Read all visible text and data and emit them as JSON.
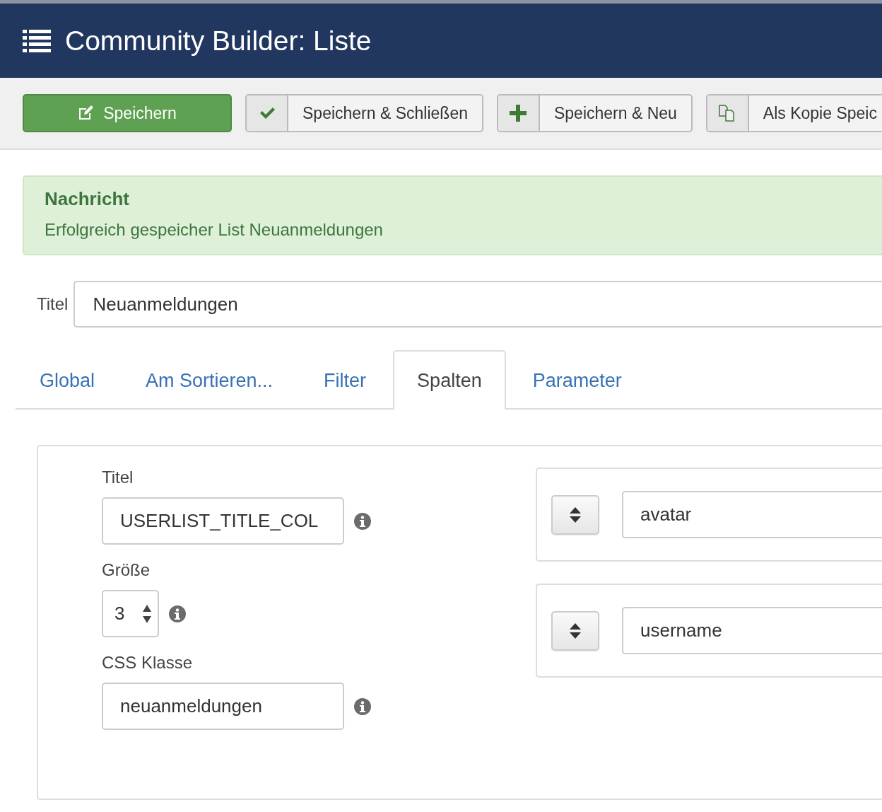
{
  "header": {
    "title": "Community Builder: Liste"
  },
  "toolbar": [
    {
      "kind": "primary",
      "label": "Speichern"
    },
    {
      "kind": "check",
      "label": "Speichern & Schließen"
    },
    {
      "kind": "plus",
      "label": "Speichern & Neu"
    },
    {
      "kind": "copy",
      "label": "Als Kopie Speic"
    }
  ],
  "message": {
    "heading": "Nachricht",
    "text": "Erfolgreich gespeicher List Neuanmeldungen"
  },
  "title_field": {
    "label": "Titel",
    "value": "Neuanmeldungen"
  },
  "tabs": [
    {
      "label": "Global",
      "selected": false
    },
    {
      "label": "Am Sortieren...",
      "selected": false
    },
    {
      "label": "Filter",
      "selected": false
    },
    {
      "label": "Spalten",
      "selected": true
    },
    {
      "label": "Parameter",
      "selected": false
    }
  ],
  "column_settings": {
    "fields": [
      {
        "kind": "text",
        "label": "Titel",
        "value": "USERLIST_TITLE_COL"
      },
      {
        "kind": "number",
        "label": "Größe",
        "value": "3"
      },
      {
        "kind": "text",
        "label": "CSS Klasse",
        "value": "neuanmeldungen"
      }
    ],
    "column_fields": [
      {
        "value": "avatar"
      },
      {
        "value": "username"
      }
    ]
  }
}
